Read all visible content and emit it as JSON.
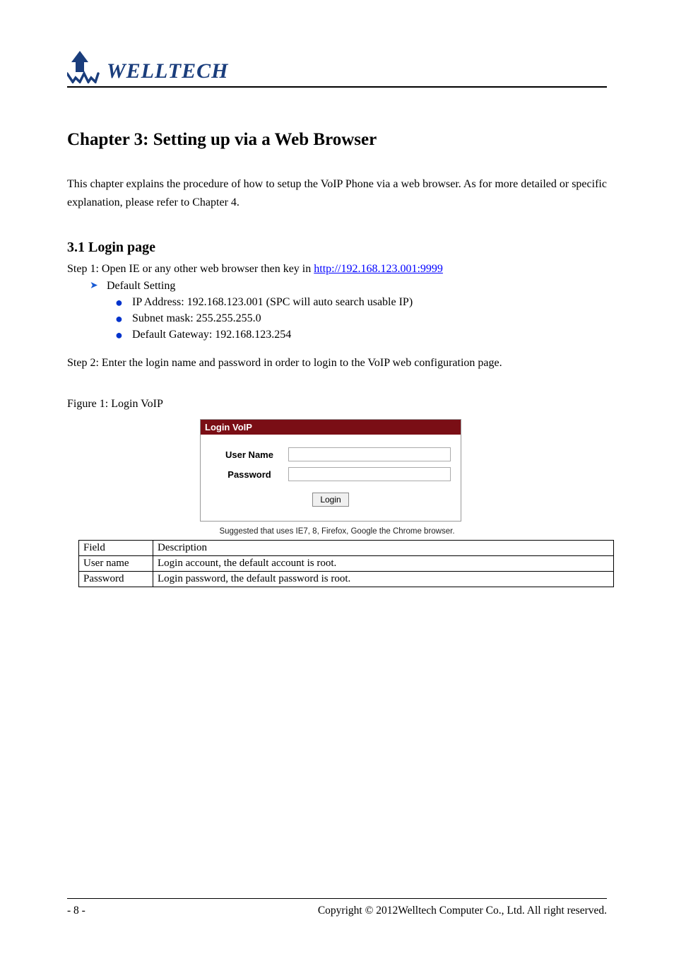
{
  "logo": {
    "brand": "WELLTECH"
  },
  "chapter": {
    "title": "Chapter 3: Setting up via a Web Browser"
  },
  "intro": {
    "text": "This chapter explains the procedure of how to setup the VoIP Phone via a web browser. As for more detailed or specific explanation, please refer to Chapter 4."
  },
  "section": {
    "heading": "3.1 Login page",
    "step1_prefix": "Step 1: Open IE or any other web browser then key in ",
    "step1_url": "http://192.168.123.001:9999",
    "default_label": "Default Setting",
    "bullets": [
      "IP Address: 192.168.123.001 (SPC will auto search usable IP)",
      "Subnet mask: 255.255.255.0",
      "Default Gateway: 192.168.123.254"
    ],
    "step2": "Step 2: Enter the login name and password in order to login to the VoIP web configuration page."
  },
  "figure": {
    "title": "Figure 1: Login VoIP",
    "login_header": "Login VoIP",
    "username_label": "User Name",
    "password_label": "Password",
    "login_button": "Login",
    "suggest": "Suggested that uses IE7, 8, Firefox, Google the Chrome browser."
  },
  "table": {
    "rows": [
      {
        "field": "Field",
        "desc": "Description"
      },
      {
        "field": "User name",
        "desc": "Login account, the default account is root."
      },
      {
        "field": "Password",
        "desc": "Login password, the default password is root."
      }
    ]
  },
  "footer": {
    "page": "- 8 -",
    "copyright": "Copyright © 2012Welltech Computer Co., Ltd. All right reserved."
  }
}
